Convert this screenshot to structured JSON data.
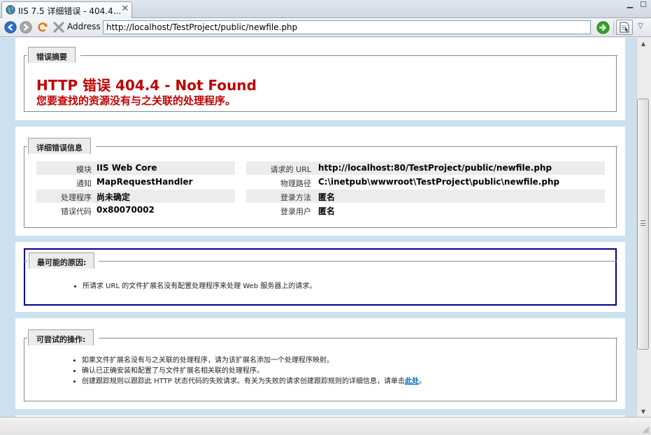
{
  "tab": {
    "title": "IIS 7.5 详细错误 - 404.4...",
    "close_glyph": "✕"
  },
  "window": {
    "minimize_glyph": "▁",
    "maximize_glyph": "☐"
  },
  "toolbar": {
    "address_label": "Address",
    "address_value": "http://localhost/TestProject/public/newfile.php",
    "menu_glyph": "▽"
  },
  "icons": {
    "tab": "globe-icon",
    "back": "back-arrow-icon",
    "forward": "forward-arrow-icon",
    "refresh": "refresh-icon",
    "stop": "stop-icon",
    "go": "go-arrow-icon",
    "page": "page-menu-icon",
    "menu": "chevron-down-icon"
  },
  "colors": {
    "error_red": "#c00000",
    "highlight_border": "#00008b",
    "link": "#0066cc",
    "page_bg": "#cbe1ef"
  },
  "summary": {
    "legend": "错误摘要",
    "heading": "HTTP 错误 404.4 - Not Found",
    "subheading": "您要查找的资源没有与之关联的处理程序。"
  },
  "details": {
    "legend": "详细错误信息",
    "left": [
      {
        "label": "模块",
        "value": "IIS Web Core"
      },
      {
        "label": "通知",
        "value": "MapRequestHandler"
      },
      {
        "label": "处理程序",
        "value": "尚未确定"
      },
      {
        "label": "错误代码",
        "value": "0x80070002"
      }
    ],
    "right": [
      {
        "label": "请求的 URL",
        "value": "http://localhost:80/TestProject/public/newfile.php"
      },
      {
        "label": "物理路径",
        "value": "C:\\inetpub\\wwwroot\\TestProject\\public\\newfile.php"
      },
      {
        "label": "登录方法",
        "value": "匿名"
      },
      {
        "label": "登录用户",
        "value": "匿名"
      }
    ]
  },
  "causes": {
    "legend": "最可能的原因:",
    "items": [
      "所请求 URL 的文件扩展名没有配置处理程序来处理 Web 服务器上的请求。"
    ]
  },
  "actions": {
    "legend": "可尝试的操作:",
    "item1": "如果文件扩展名没有与之关联的处理程序，请为该扩展名添加一个处理程序映射。",
    "item2": "确认已正确安装和配置了与文件扩展名相关联的处理程序。",
    "item3_prefix": "创建跟踪规则以跟踪此 HTTP 状态代码的失败请求。有关为失败的请求创建跟踪规则的详细信息，请单击",
    "item3_link": "此处",
    "item3_suffix": "。"
  },
  "scrollbar": {
    "up_glyph": "▲",
    "down_glyph": "▼"
  },
  "status": {
    "text": ""
  }
}
